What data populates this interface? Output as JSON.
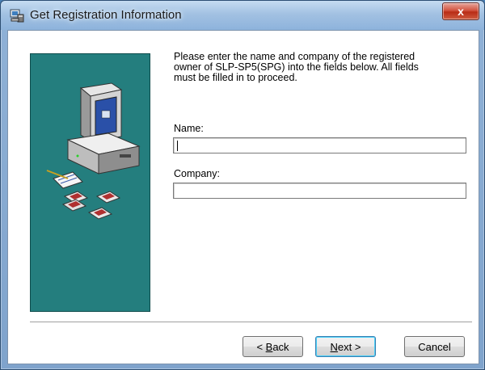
{
  "window": {
    "title": "Get Registration Information",
    "close_label": "x"
  },
  "prompt": {
    "line1": "Please enter the name and company of the registered",
    "line2": "owner of SLP-SP5(SPG) into the fields below. All fields",
    "line3": "must be filled in to proceed."
  },
  "form": {
    "name_label": "Name:",
    "name_value": "",
    "company_label": "Company:",
    "company_value": ""
  },
  "buttons": {
    "back_prefix": "< ",
    "back_mnemonic": "B",
    "back_suffix": "ack",
    "next_mnemonic": "N",
    "next_suffix": "ext >",
    "cancel": "Cancel"
  },
  "colors": {
    "side_panel": "#247e7e",
    "titlebar": "#a2c1e2",
    "close_button": "#c8432b"
  },
  "icons": {
    "title": "setup-icon",
    "close": "close-icon",
    "side_art": "computer-with-disks-illustration"
  }
}
